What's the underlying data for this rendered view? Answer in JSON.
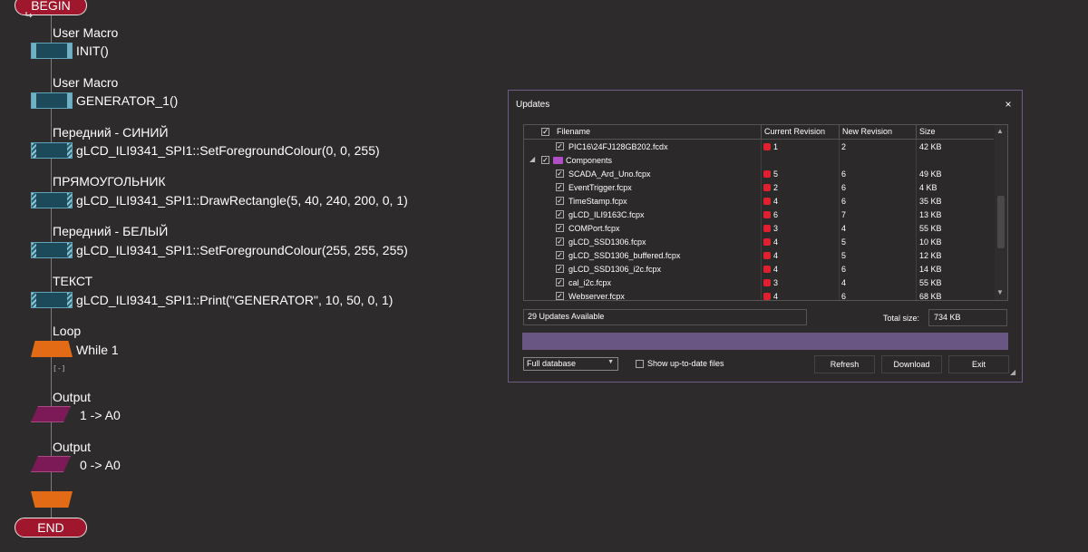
{
  "flowchart": {
    "begin": "BEGIN",
    "end": "END",
    "blocks": [
      {
        "label": "User Macro",
        "text": "INIT()"
      },
      {
        "label": "User Macro",
        "text": "GENERATOR_1()"
      },
      {
        "label": "Передний - СИНИЙ",
        "text": "gLCD_ILI9341_SPI1::SetForegroundColour(0, 0, 255)"
      },
      {
        "label": "ПРЯМОУГОЛЬНИК",
        "text": "gLCD_ILI9341_SPI1::DrawRectangle(5, 40, 240, 200, 0, 1)"
      },
      {
        "label": "Передний - БЕЛЫЙ",
        "text": "gLCD_ILI9341_SPI1::SetForegroundColour(255, 255, 255)"
      },
      {
        "label": "ТЕКСТ",
        "text": "gLCD_ILI9341_SPI1::Print(\"GENERATOR\", 10, 50, 0, 1)"
      }
    ],
    "loop": {
      "label": "Loop",
      "text": "While 1",
      "collapse": "[-]"
    },
    "outputs": [
      {
        "label": "Output",
        "text": "1 -> A0"
      },
      {
        "label": "Output",
        "text": "0 -> A0"
      }
    ]
  },
  "dialog": {
    "title": "Updates",
    "close": "×",
    "columns": [
      "Filename",
      "Current Revision",
      "New Revision",
      "Size"
    ],
    "rows": [
      {
        "name": "PIC16\\24FJ128GB202.fcdx",
        "current": "1",
        "new": "2",
        "size": "42 KB"
      },
      {
        "name": "Components",
        "group": true
      },
      {
        "name": "SCADA_Ard_Uno.fcpx",
        "current": "5",
        "new": "6",
        "size": "49 KB"
      },
      {
        "name": "EventTrigger.fcpx",
        "current": "2",
        "new": "6",
        "size": "4 KB"
      },
      {
        "name": "TimeStamp.fcpx",
        "current": "4",
        "new": "6",
        "size": "35 KB"
      },
      {
        "name": "gLCD_ILI9163C.fcpx",
        "current": "6",
        "new": "7",
        "size": "13 KB"
      },
      {
        "name": "COMPort.fcpx",
        "current": "3",
        "new": "4",
        "size": "55 KB"
      },
      {
        "name": "gLCD_SSD1306.fcpx",
        "current": "4",
        "new": "5",
        "size": "10 KB"
      },
      {
        "name": "gLCD_SSD1306_buffered.fcpx",
        "current": "4",
        "new": "5",
        "size": "12 KB"
      },
      {
        "name": "gLCD_SSD1306_i2c.fcpx",
        "current": "4",
        "new": "6",
        "size": "14 KB"
      },
      {
        "name": "cal_i2c.fcpx",
        "current": "3",
        "new": "4",
        "size": "55 KB"
      },
      {
        "name": "Webserver.fcpx",
        "current": "4",
        "new": "6",
        "size": "68 KB"
      }
    ],
    "status": "29 Updates Available",
    "total_label": "Total size:",
    "total_value": "734 KB",
    "select_value": "Full database",
    "show_label": "Show up-to-date files",
    "buttons": {
      "refresh": "Refresh",
      "download": "Download",
      "exit": "Exit"
    },
    "colors": {
      "accent": "#6a5683",
      "revision_marker": "#e0202e",
      "folder": "#b04fc8"
    }
  }
}
